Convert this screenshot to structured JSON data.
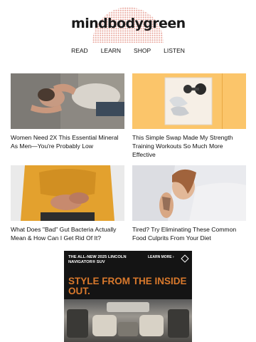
{
  "brand": {
    "logo_text": "mindbodygreen"
  },
  "nav": {
    "items": [
      "READ",
      "LEARN",
      "SHOP",
      "LISTEN"
    ]
  },
  "articles": [
    {
      "title": "Women Need 2X This Essential Mineral As Men—You're Probably Low",
      "image": "man-lying-hands-on-face"
    },
    {
      "title": "This Simple Swap Made My Strength Training Workouts So Much More Effective",
      "image": "sneakers-and-dumbbell"
    },
    {
      "title": "What Does \"Bad\" Gut Bacteria Actually Mean & How Can I Get Rid Of It?",
      "image": "hands-holding-stomach"
    },
    {
      "title": "Tired? Try Eliminating These Common Food Culprits From Your Diet",
      "image": "woman-sleeping-in-bed"
    }
  ],
  "ad": {
    "top_line": "THE ALL-NEW 2025 LINCOLN NAVIGATOR® SUV",
    "learn_more": "LEARN MORE ›",
    "headline": "STYLE FROM THE INSIDE OUT."
  },
  "colors": {
    "logo_dots": "#e9a79d",
    "ad_headline": "#d9792c",
    "ad_bg": "#141414",
    "thumb_yellow": "#fbc56a"
  }
}
